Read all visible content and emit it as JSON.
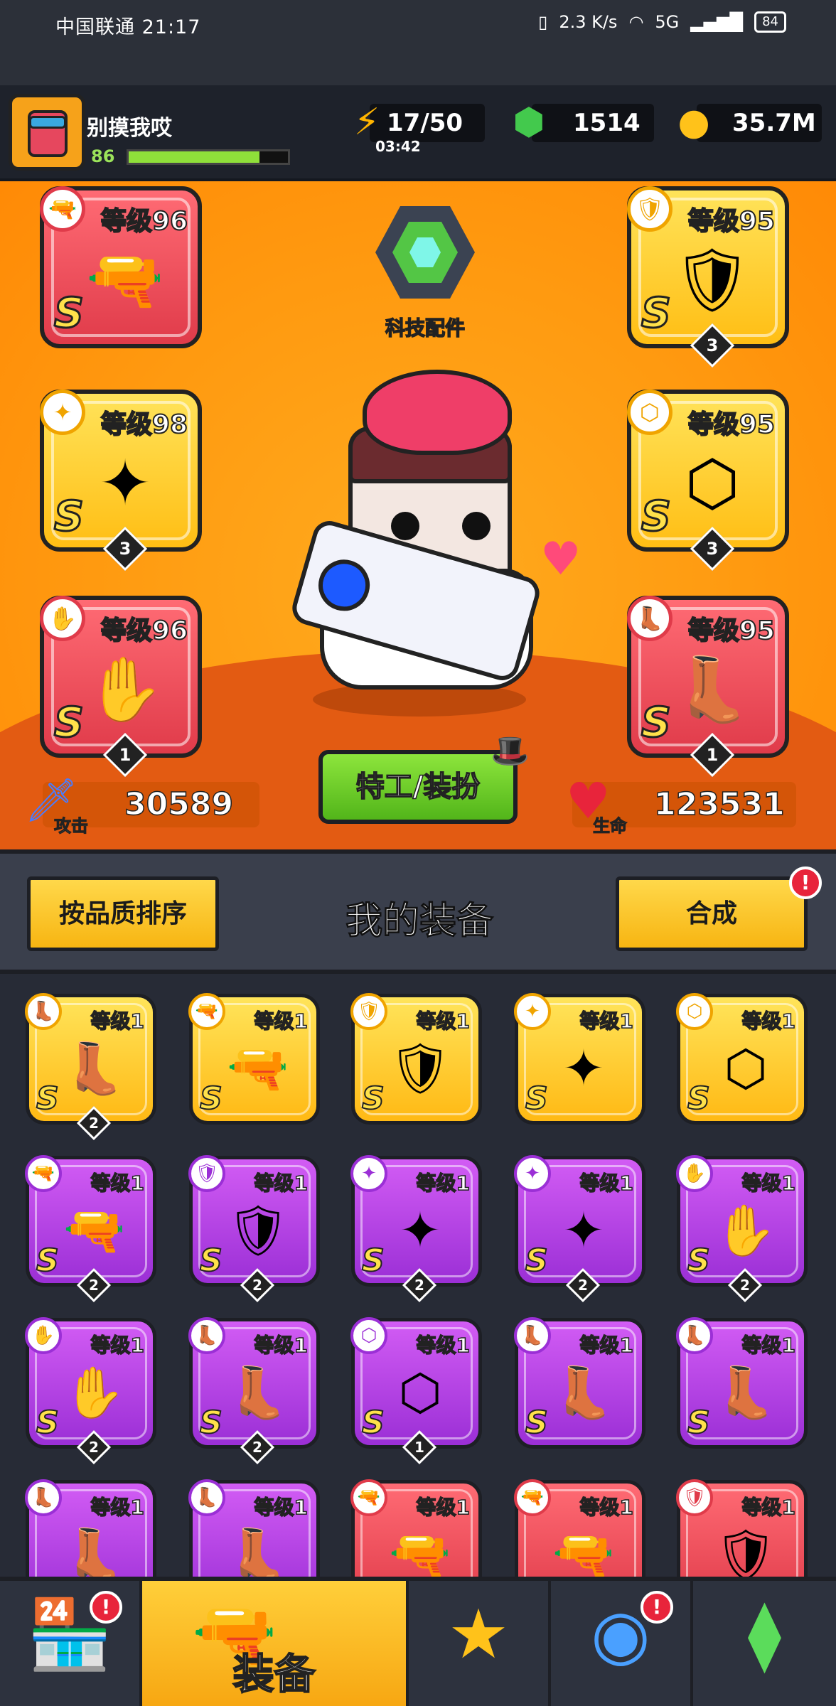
{
  "status_bar": {
    "carrier_time": "中国联通 21:17",
    "speed": "2.3 K/s",
    "network": "5G",
    "battery": "84"
  },
  "player": {
    "name": "别摸我哎",
    "level": "86",
    "xp_fraction": 0.82
  },
  "resources": {
    "energy": "17/50",
    "energy_timer": "03:42",
    "gems": "1514",
    "coins": "35.7M"
  },
  "hero": {
    "tech_label": "科技配件",
    "attack_label": "攻击",
    "attack_value": "30589",
    "hp_label": "生命",
    "hp_value": "123531",
    "costume_button": "特工/装扮"
  },
  "equipped": [
    {
      "level": "等级96",
      "rank": "S",
      "stars": "",
      "color": "red",
      "slot_icon": "gun-icon"
    },
    {
      "level": "等级98",
      "rank": "S",
      "stars": "3",
      "color": "gold",
      "slot_icon": "necklace-icon"
    },
    {
      "level": "等级96",
      "rank": "S",
      "stars": "1",
      "color": "red",
      "slot_icon": "glove-icon"
    },
    {
      "level": "等级95",
      "rank": "S",
      "stars": "3",
      "color": "gold",
      "slot_icon": "armor-icon"
    },
    {
      "level": "等级95",
      "rank": "S",
      "stars": "3",
      "color": "gold",
      "slot_icon": "belt-icon"
    },
    {
      "level": "等级95",
      "rank": "S",
      "stars": "1",
      "color": "red",
      "slot_icon": "boots-icon"
    }
  ],
  "section": {
    "sort_button": "按品质排序",
    "title": "我的装备",
    "merge_button": "合成",
    "merge_alert": "!"
  },
  "inventory": [
    {
      "level": "等级1",
      "rank": "S",
      "stars": "2",
      "color": "gold",
      "slot_icon": "boots-icon"
    },
    {
      "level": "等级1",
      "rank": "S",
      "stars": "",
      "color": "gold",
      "slot_icon": "gun-icon"
    },
    {
      "level": "等级1",
      "rank": "S",
      "stars": "",
      "color": "gold",
      "slot_icon": "armor-icon"
    },
    {
      "level": "等级1",
      "rank": "S",
      "stars": "",
      "color": "gold",
      "slot_icon": "necklace-icon"
    },
    {
      "level": "等级1",
      "rank": "S",
      "stars": "",
      "color": "gold",
      "slot_icon": "belt-icon"
    },
    {
      "level": "等级1",
      "rank": "S",
      "stars": "2",
      "color": "purple",
      "slot_icon": "gun-icon"
    },
    {
      "level": "等级1",
      "rank": "S",
      "stars": "2",
      "color": "purple",
      "slot_icon": "armor-icon"
    },
    {
      "level": "等级1",
      "rank": "S",
      "stars": "2",
      "color": "purple",
      "slot_icon": "necklace-icon"
    },
    {
      "level": "等级1",
      "rank": "S",
      "stars": "2",
      "color": "purple",
      "slot_icon": "necklace-icon"
    },
    {
      "level": "等级1",
      "rank": "S",
      "stars": "2",
      "color": "purple",
      "slot_icon": "glove-icon"
    },
    {
      "level": "等级1",
      "rank": "S",
      "stars": "2",
      "color": "purple",
      "slot_icon": "glove-icon"
    },
    {
      "level": "等级1",
      "rank": "S",
      "stars": "2",
      "color": "purple",
      "slot_icon": "boots-icon"
    },
    {
      "level": "等级1",
      "rank": "S",
      "stars": "1",
      "color": "purple",
      "slot_icon": "belt-icon"
    },
    {
      "level": "等级1",
      "rank": "S",
      "stars": "",
      "color": "purple",
      "slot_icon": "boots-icon"
    },
    {
      "level": "等级1",
      "rank": "S",
      "stars": "",
      "color": "purple",
      "slot_icon": "boots-icon"
    },
    {
      "level": "等级1",
      "rank": "",
      "stars": "",
      "color": "purple",
      "slot_icon": "boots-icon"
    },
    {
      "level": "等级1",
      "rank": "",
      "stars": "",
      "color": "purple",
      "slot_icon": "boots-icon"
    },
    {
      "level": "等级1",
      "rank": "",
      "stars": "",
      "color": "red",
      "slot_icon": "gun-icon"
    },
    {
      "level": "等级1",
      "rank": "",
      "stars": "",
      "color": "red",
      "slot_icon": "gun-icon"
    },
    {
      "level": "等级1",
      "rank": "",
      "stars": "",
      "color": "red",
      "slot_icon": "armor-icon"
    }
  ],
  "nav": {
    "shop_alert": "!",
    "equip_label": "装备",
    "gacha_alert": "!"
  }
}
